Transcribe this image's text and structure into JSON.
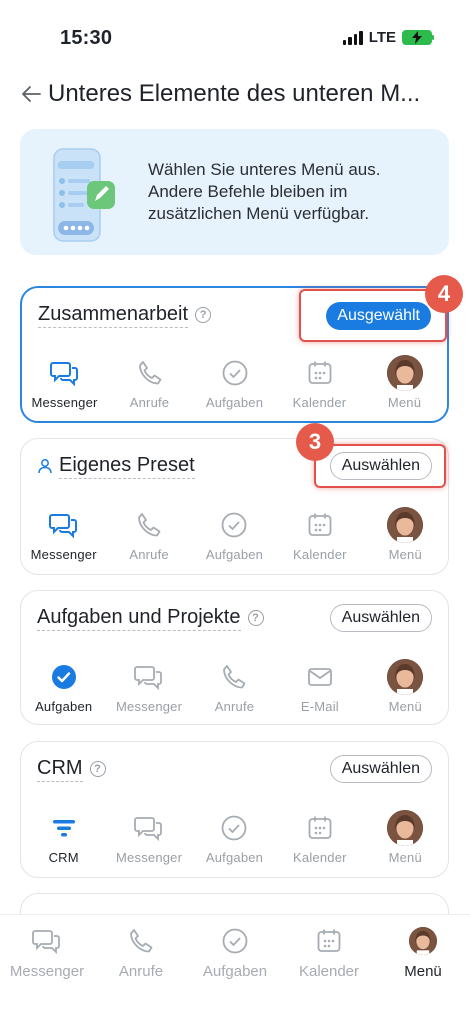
{
  "status_bar": {
    "time": "15:30",
    "network": "LTE"
  },
  "header": {
    "title": "Unteres Elemente des unteren M..."
  },
  "banner": {
    "text": "Wählen Sie unteres Menü aus. Andere Befehle bleiben im zusätzlichen Menü verfügbar."
  },
  "cards": [
    {
      "title": "Zusammenarbeit",
      "button": "Ausgewählt",
      "items": [
        "Messenger",
        "Anrufe",
        "Aufgaben",
        "Kalender",
        "Menü"
      ]
    },
    {
      "title": "Eigenes Preset",
      "button": "Auswählen",
      "items": [
        "Messenger",
        "Anrufe",
        "Aufgaben",
        "Kalender",
        "Menü"
      ]
    },
    {
      "title": "Aufgaben und Projekte",
      "button": "Auswählen",
      "items": [
        "Aufgaben",
        "Messenger",
        "Anrufe",
        "E-Mail",
        "Menü"
      ]
    },
    {
      "title": "CRM",
      "button": "Auswählen",
      "items": [
        "CRM",
        "Messenger",
        "Aufgaben",
        "Kalender",
        "Menü"
      ]
    }
  ],
  "annotations": {
    "first": "4",
    "second": "3"
  },
  "tab_bar": {
    "items": [
      "Messenger",
      "Anrufe",
      "Aufgaben",
      "Kalender",
      "Menü"
    ]
  },
  "colors": {
    "accent": "#1a7ce0",
    "annotation": "#e55a4a",
    "banner_bg": "#e6f3fc"
  }
}
